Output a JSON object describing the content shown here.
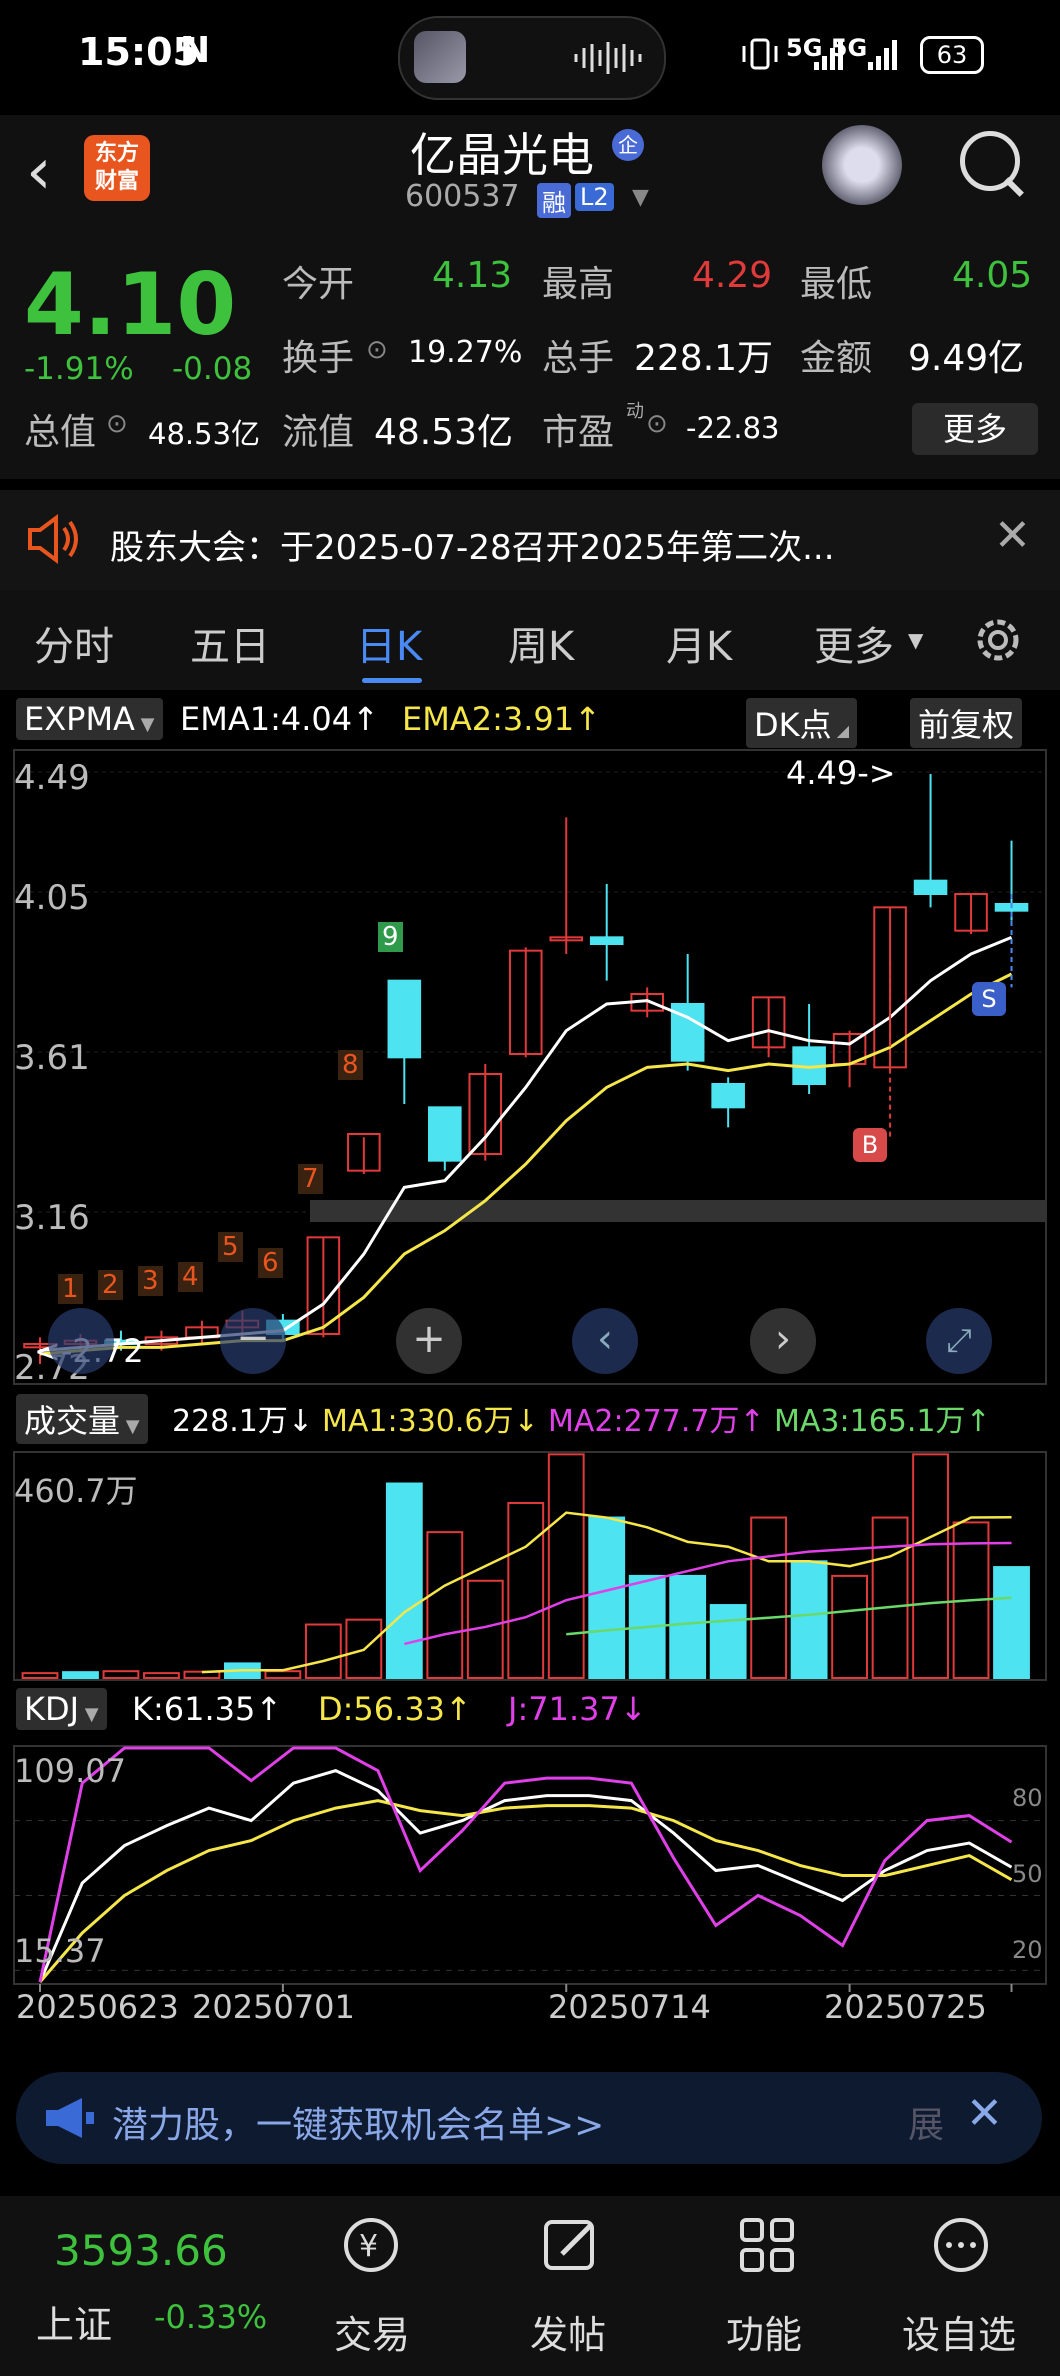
{
  "status": {
    "time": "15:05",
    "nfc": "N",
    "network": "5G 5G",
    "battery": "63"
  },
  "header": {
    "logo_line1": "东方",
    "logo_line2": "财富",
    "stock_name": "亿晶光电",
    "badge": "企",
    "code": "600537",
    "tag_rong": "融",
    "tag_l2": "L2"
  },
  "quote": {
    "price": "4.10",
    "change_pct": "-1.91%",
    "change_abs": "-0.08",
    "open_label": "今开",
    "open": "4.13",
    "high_label": "最高",
    "high": "4.29",
    "low_label": "最低",
    "low": "4.05",
    "turnover_label": "换手",
    "turnover": "19.27%",
    "volume_label": "总手",
    "volume": "228.1万",
    "amount_label": "金额",
    "amount": "9.49亿",
    "mktcap_label": "总值",
    "mktcap": "48.53亿",
    "float_label": "流值",
    "float": "48.53亿",
    "pe_label": "市盈",
    "pe_sup": "动",
    "pe": "-22.83",
    "more": "更多"
  },
  "notice": {
    "text": "股东大会：于2025-07-28召开2025年第二次..."
  },
  "tabs": [
    {
      "label": "分时"
    },
    {
      "label": "五日"
    },
    {
      "label": "日K"
    },
    {
      "label": "周K"
    },
    {
      "label": "月K"
    },
    {
      "label": "更多"
    }
  ],
  "indicator": {
    "expma": "EXPMA",
    "ema1": "EMA1:4.04↑",
    "ema2": "EMA2:3.91↑",
    "dk": "DK点",
    "fuquan": "前复权",
    "vol": "成交量",
    "vol_val": "228.1万↓",
    "ma1": "MA1:330.6万↓",
    "ma2": "MA2:277.7万↑",
    "ma3": "MA3:165.1万↑",
    "kdj": "KDJ",
    "k": "K:61.35↑",
    "d": "D:56.33↑",
    "j": "J:71.37↓"
  },
  "colors": {
    "up": "#e03a3a",
    "down": "#4de3f0",
    "green": "#3ec23e",
    "blue": "#4a8af4"
  },
  "chart_data": [
    {
      "type": "candlestick",
      "title": "",
      "yaxis_ticks": [
        "4.49",
        "4.05",
        "3.61",
        "3.16",
        "2.72"
      ],
      "ylim": [
        2.72,
        4.49
      ],
      "annotations": {
        "high_label": "4.49->",
        "low_label": "<-2.72",
        "buy": "B",
        "sell": "S"
      },
      "td_counts": [
        "1",
        "2",
        "3",
        "4",
        "5",
        "6",
        "7",
        "8",
        "9"
      ],
      "candles": [
        {
          "o": 2.77,
          "h": 2.8,
          "l": 2.72,
          "c": 2.78
        },
        {
          "o": 2.78,
          "h": 2.81,
          "l": 2.75,
          "c": 2.79
        },
        {
          "o": 2.79,
          "h": 2.82,
          "l": 2.76,
          "c": 2.78
        },
        {
          "o": 2.78,
          "h": 2.82,
          "l": 2.76,
          "c": 2.8
        },
        {
          "o": 2.8,
          "h": 2.85,
          "l": 2.78,
          "c": 2.83
        },
        {
          "o": 2.83,
          "h": 2.88,
          "l": 2.8,
          "c": 2.85
        },
        {
          "o": 2.85,
          "h": 2.87,
          "l": 2.79,
          "c": 2.81
        },
        {
          "o": 2.81,
          "h": 3.1,
          "l": 2.8,
          "c": 3.1
        },
        {
          "o": 3.3,
          "h": 3.4,
          "l": 3.29,
          "c": 3.41
        },
        {
          "o": 3.87,
          "h": 3.87,
          "l": 3.5,
          "c": 3.64
        },
        {
          "o": 3.49,
          "h": 3.49,
          "l": 3.3,
          "c": 3.33
        },
        {
          "o": 3.35,
          "h": 3.62,
          "l": 3.33,
          "c": 3.59
        },
        {
          "o": 3.65,
          "h": 3.97,
          "l": 3.64,
          "c": 3.96
        },
        {
          "o": 4.0,
          "h": 4.36,
          "l": 3.95,
          "c": 4.0
        },
        {
          "o": 4.0,
          "h": 4.16,
          "l": 3.87,
          "c": 3.98
        },
        {
          "o": 3.78,
          "h": 3.85,
          "l": 3.76,
          "c": 3.83
        },
        {
          "o": 3.8,
          "h": 3.95,
          "l": 3.6,
          "c": 3.63
        },
        {
          "o": 3.56,
          "h": 3.58,
          "l": 3.43,
          "c": 3.49
        },
        {
          "o": 3.67,
          "h": 3.82,
          "l": 3.64,
          "c": 3.82
        },
        {
          "o": 3.67,
          "h": 3.8,
          "l": 3.53,
          "c": 3.56
        },
        {
          "o": 3.62,
          "h": 3.72,
          "l": 3.55,
          "c": 3.71
        },
        {
          "o": 3.61,
          "h": 4.09,
          "l": 3.6,
          "c": 4.09
        },
        {
          "o": 4.17,
          "h": 4.49,
          "l": 4.09,
          "c": 4.13
        },
        {
          "o": 4.02,
          "h": 4.13,
          "l": 4.01,
          "c": 4.13
        },
        {
          "o": 4.1,
          "h": 4.29,
          "l": 4.05,
          "c": 4.08
        }
      ],
      "ema1": [
        2.76,
        2.77,
        2.78,
        2.79,
        2.8,
        2.81,
        2.82,
        2.9,
        3.05,
        3.25,
        3.27,
        3.4,
        3.55,
        3.72,
        3.8,
        3.81,
        3.76,
        3.69,
        3.72,
        3.69,
        3.68,
        3.76,
        3.87,
        3.95,
        4.0
      ],
      "ema2": [
        2.75,
        2.76,
        2.77,
        2.77,
        2.78,
        2.79,
        2.79,
        2.83,
        2.92,
        3.05,
        3.12,
        3.21,
        3.32,
        3.45,
        3.55,
        3.61,
        3.62,
        3.6,
        3.62,
        3.61,
        3.62,
        3.67,
        3.75,
        3.83,
        3.89
      ]
    },
    {
      "type": "bar",
      "title": "",
      "yaxis_top": "460.7万",
      "ylim": [
        0,
        460.7
      ],
      "values": [
        10,
        12,
        14,
        10,
        13,
        30,
        14,
        110,
        120,
        400,
        300,
        200,
        360,
        460,
        330,
        210,
        210,
        150,
        330,
        240,
        210,
        330,
        460,
        320,
        228.1
      ],
      "up": [
        true,
        false,
        true,
        true,
        true,
        false,
        true,
        true,
        true,
        false,
        true,
        true,
        true,
        true,
        false,
        false,
        false,
        false,
        true,
        false,
        true,
        true,
        true,
        true,
        false
      ],
      "ma1": [
        null,
        null,
        null,
        null,
        12,
        16,
        16,
        35,
        58,
        135,
        190,
        230,
        270,
        340,
        330,
        310,
        280,
        270,
        240,
        240,
        230,
        250,
        290,
        330,
        330.6
      ],
      "ma2": [
        null,
        null,
        null,
        null,
        null,
        null,
        null,
        null,
        null,
        70,
        90,
        105,
        125,
        160,
        180,
        200,
        220,
        240,
        250,
        260,
        265,
        270,
        275,
        277,
        277.7
      ],
      "ma3": [
        null,
        null,
        null,
        null,
        null,
        null,
        null,
        null,
        null,
        null,
        null,
        null,
        null,
        90,
        98,
        105,
        112,
        118,
        124,
        130,
        138,
        146,
        154,
        160,
        165.1
      ]
    },
    {
      "type": "line",
      "title": "",
      "yaxis_top": "109.07",
      "yaxis_bottom": "15.37",
      "ylim": [
        15.37,
        109.07
      ],
      "grid_labels": [
        "80",
        "50",
        "20"
      ],
      "x_labels": [
        "20250623",
        "20250701",
        "20250714",
        "20250725"
      ],
      "k": [
        15,
        55,
        70,
        78,
        85,
        80,
        95,
        100,
        92,
        75,
        80,
        88,
        90,
        90,
        88,
        75,
        60,
        62,
        55,
        48,
        60,
        68,
        71,
        61.35
      ],
      "d": [
        15,
        35,
        50,
        60,
        68,
        72,
        80,
        85,
        88,
        84,
        82,
        85,
        86,
        86,
        85,
        80,
        72,
        68,
        62,
        58,
        58,
        62,
        66,
        56.33
      ],
      "j": [
        15,
        95,
        110,
        115,
        115,
        96,
        124,
        130,
        100,
        60,
        76,
        95,
        97,
        97,
        95,
        65,
        38,
        50,
        42,
        30,
        64,
        80,
        82,
        71.37
      ]
    }
  ],
  "banner": {
    "text": "潜力股，一键获取机会名单>>",
    "tail": "展"
  },
  "bottomnav": {
    "index_value": "3593.66",
    "index_name": "上证",
    "index_change": "-0.33%",
    "items": [
      {
        "label": "交易"
      },
      {
        "label": "发帖"
      },
      {
        "label": "功能"
      },
      {
        "label": "设自选"
      }
    ]
  }
}
